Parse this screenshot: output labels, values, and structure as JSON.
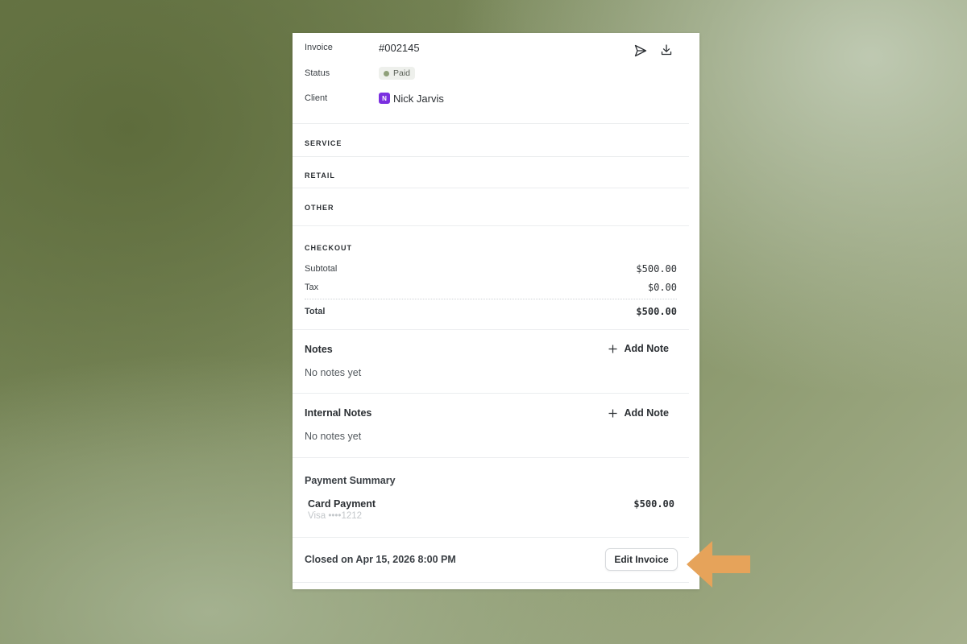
{
  "invoice": {
    "invoice_label": "Invoice",
    "invoice_number": "#002145",
    "status_label": "Status",
    "status_value": "Paid",
    "client_label": "Client",
    "client_initial": "N",
    "client_name": "Nick Jarvis",
    "actions": {
      "send_icon": "send-icon",
      "download_icon": "download-icon"
    }
  },
  "sections": {
    "service": "SERVICE",
    "retail": "RETAIL",
    "other": "OTHER"
  },
  "checkout": {
    "title": "CHECKOUT",
    "subtotal_label": "Subtotal",
    "subtotal_value": "$500.00",
    "tax_label": "Tax",
    "tax_value": "$0.00",
    "total_label": "Total",
    "total_value": "$500.00"
  },
  "notes": {
    "title": "Notes",
    "add_label": "Add Note",
    "empty": "No notes yet"
  },
  "internal_notes": {
    "title": "Internal Notes",
    "add_label": "Add Note",
    "empty": "No notes yet"
  },
  "payment_summary": {
    "title": "Payment Summary",
    "method": "Card Payment",
    "card": "Visa ••••1212",
    "amount": "$500.00"
  },
  "footer": {
    "closed_text": "Closed on Apr 15, 2026 8:00 PM",
    "edit_button": "Edit Invoice"
  },
  "colors": {
    "accent_avatar": "#7b2fe0",
    "status_dot": "#8fa07a",
    "arrow": "#e6a35a"
  }
}
